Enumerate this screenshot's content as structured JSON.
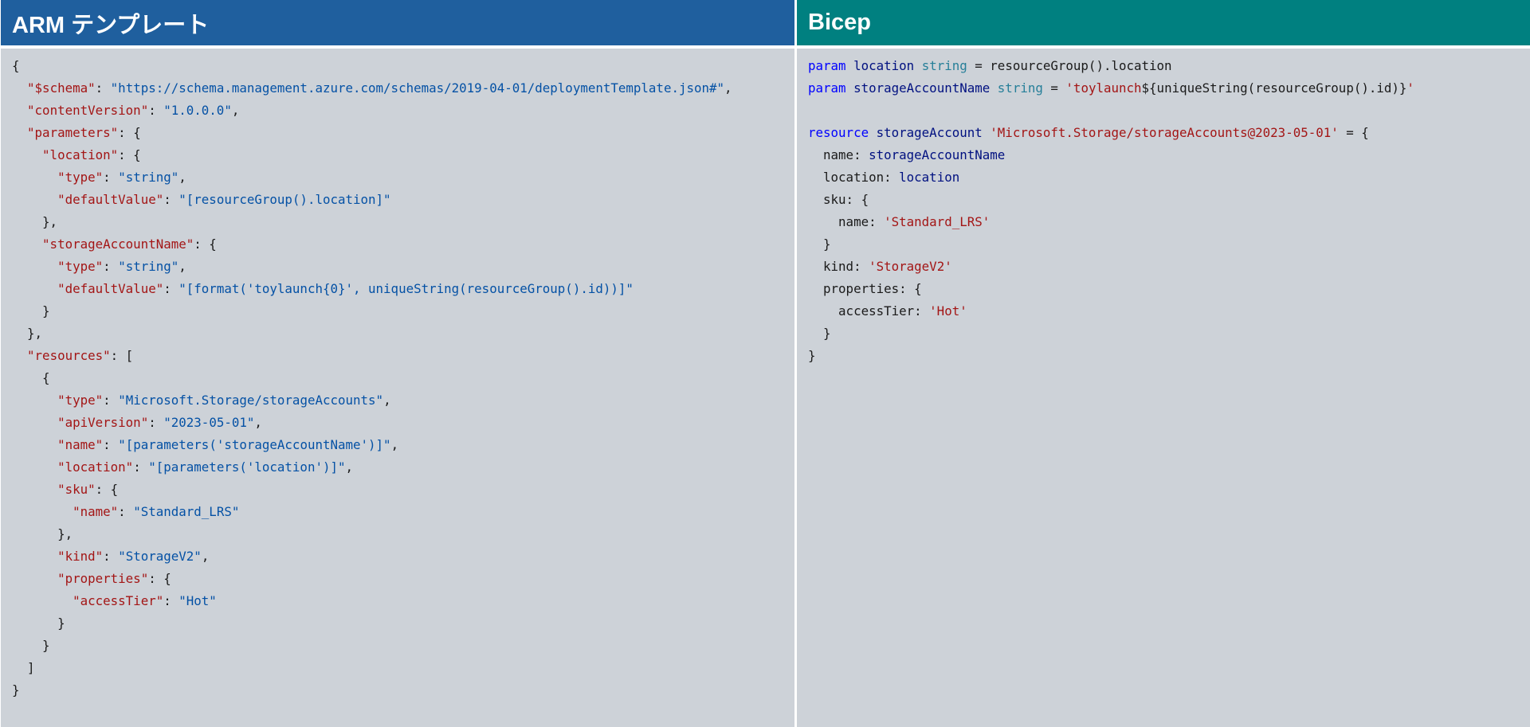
{
  "left": {
    "title": "ARM テンプレート",
    "lines": [
      [
        {
          "t": "p",
          "v": "{"
        }
      ],
      [
        {
          "t": "p",
          "v": "  "
        },
        {
          "t": "k",
          "v": "\"$schema\""
        },
        {
          "t": "p",
          "v": ": "
        },
        {
          "t": "v",
          "v": "\"https://schema.management.azure.com/schemas/2019-04-01/deploymentTemplate.json#\""
        },
        {
          "t": "p",
          "v": ","
        }
      ],
      [
        {
          "t": "p",
          "v": "  "
        },
        {
          "t": "k",
          "v": "\"contentVersion\""
        },
        {
          "t": "p",
          "v": ": "
        },
        {
          "t": "v",
          "v": "\"1.0.0.0\""
        },
        {
          "t": "p",
          "v": ","
        }
      ],
      [
        {
          "t": "p",
          "v": "  "
        },
        {
          "t": "k",
          "v": "\"parameters\""
        },
        {
          "t": "p",
          "v": ": {"
        }
      ],
      [
        {
          "t": "p",
          "v": "    "
        },
        {
          "t": "k",
          "v": "\"location\""
        },
        {
          "t": "p",
          "v": ": {"
        }
      ],
      [
        {
          "t": "p",
          "v": "      "
        },
        {
          "t": "k",
          "v": "\"type\""
        },
        {
          "t": "p",
          "v": ": "
        },
        {
          "t": "v",
          "v": "\"string\""
        },
        {
          "t": "p",
          "v": ","
        }
      ],
      [
        {
          "t": "p",
          "v": "      "
        },
        {
          "t": "k",
          "v": "\"defaultValue\""
        },
        {
          "t": "p",
          "v": ": "
        },
        {
          "t": "v",
          "v": "\"[resourceGroup().location]\""
        }
      ],
      [
        {
          "t": "p",
          "v": "    },"
        }
      ],
      [
        {
          "t": "p",
          "v": "    "
        },
        {
          "t": "k",
          "v": "\"storageAccountName\""
        },
        {
          "t": "p",
          "v": ": {"
        }
      ],
      [
        {
          "t": "p",
          "v": "      "
        },
        {
          "t": "k",
          "v": "\"type\""
        },
        {
          "t": "p",
          "v": ": "
        },
        {
          "t": "v",
          "v": "\"string\""
        },
        {
          "t": "p",
          "v": ","
        }
      ],
      [
        {
          "t": "p",
          "v": "      "
        },
        {
          "t": "k",
          "v": "\"defaultValue\""
        },
        {
          "t": "p",
          "v": ": "
        },
        {
          "t": "v",
          "v": "\"[format('toylaunch{0}', uniqueString(resourceGroup().id))]\""
        }
      ],
      [
        {
          "t": "p",
          "v": "    }"
        }
      ],
      [
        {
          "t": "p",
          "v": "  },"
        }
      ],
      [
        {
          "t": "p",
          "v": "  "
        },
        {
          "t": "k",
          "v": "\"resources\""
        },
        {
          "t": "p",
          "v": ": ["
        }
      ],
      [
        {
          "t": "p",
          "v": "    {"
        }
      ],
      [
        {
          "t": "p",
          "v": "      "
        },
        {
          "t": "k",
          "v": "\"type\""
        },
        {
          "t": "p",
          "v": ": "
        },
        {
          "t": "v",
          "v": "\"Microsoft.Storage/storageAccounts\""
        },
        {
          "t": "p",
          "v": ","
        }
      ],
      [
        {
          "t": "p",
          "v": "      "
        },
        {
          "t": "k",
          "v": "\"apiVersion\""
        },
        {
          "t": "p",
          "v": ": "
        },
        {
          "t": "v",
          "v": "\"2023-05-01\""
        },
        {
          "t": "p",
          "v": ","
        }
      ],
      [
        {
          "t": "p",
          "v": "      "
        },
        {
          "t": "k",
          "v": "\"name\""
        },
        {
          "t": "p",
          "v": ": "
        },
        {
          "t": "v",
          "v": "\"[parameters('storageAccountName')]\""
        },
        {
          "t": "p",
          "v": ","
        }
      ],
      [
        {
          "t": "p",
          "v": "      "
        },
        {
          "t": "k",
          "v": "\"location\""
        },
        {
          "t": "p",
          "v": ": "
        },
        {
          "t": "v",
          "v": "\"[parameters('location')]\""
        },
        {
          "t": "p",
          "v": ","
        }
      ],
      [
        {
          "t": "p",
          "v": "      "
        },
        {
          "t": "k",
          "v": "\"sku\""
        },
        {
          "t": "p",
          "v": ": {"
        }
      ],
      [
        {
          "t": "p",
          "v": "        "
        },
        {
          "t": "k",
          "v": "\"name\""
        },
        {
          "t": "p",
          "v": ": "
        },
        {
          "t": "v",
          "v": "\"Standard_LRS\""
        }
      ],
      [
        {
          "t": "p",
          "v": "      },"
        }
      ],
      [
        {
          "t": "p",
          "v": "      "
        },
        {
          "t": "k",
          "v": "\"kind\""
        },
        {
          "t": "p",
          "v": ": "
        },
        {
          "t": "v",
          "v": "\"StorageV2\""
        },
        {
          "t": "p",
          "v": ","
        }
      ],
      [
        {
          "t": "p",
          "v": "      "
        },
        {
          "t": "k",
          "v": "\"properties\""
        },
        {
          "t": "p",
          "v": ": {"
        }
      ],
      [
        {
          "t": "p",
          "v": "        "
        },
        {
          "t": "k",
          "v": "\"accessTier\""
        },
        {
          "t": "p",
          "v": ": "
        },
        {
          "t": "v",
          "v": "\"Hot\""
        }
      ],
      [
        {
          "t": "p",
          "v": "      }"
        }
      ],
      [
        {
          "t": "p",
          "v": "    }"
        }
      ],
      [
        {
          "t": "p",
          "v": "  ]"
        }
      ],
      [
        {
          "t": "p",
          "v": "}"
        }
      ]
    ]
  },
  "right": {
    "title": "Bicep",
    "lines": [
      [
        {
          "t": "kw",
          "v": "param"
        },
        {
          "t": "p",
          "v": " "
        },
        {
          "t": "id",
          "v": "location"
        },
        {
          "t": "p",
          "v": " "
        },
        {
          "t": "ty",
          "v": "string"
        },
        {
          "t": "p",
          "v": " = resourceGroup().location"
        }
      ],
      [
        {
          "t": "kw",
          "v": "param"
        },
        {
          "t": "p",
          "v": " "
        },
        {
          "t": "id",
          "v": "storageAccountName"
        },
        {
          "t": "p",
          "v": " "
        },
        {
          "t": "ty",
          "v": "string"
        },
        {
          "t": "p",
          "v": " = "
        },
        {
          "t": "s",
          "v": "'toylaunch"
        },
        {
          "t": "p",
          "v": "${uniqueString(resourceGroup().id)}"
        },
        {
          "t": "s",
          "v": "'"
        }
      ],
      [
        {
          "t": "p",
          "v": ""
        }
      ],
      [
        {
          "t": "kw",
          "v": "resource"
        },
        {
          "t": "p",
          "v": " "
        },
        {
          "t": "id",
          "v": "storageAccount"
        },
        {
          "t": "p",
          "v": " "
        },
        {
          "t": "s",
          "v": "'Microsoft.Storage/storageAccounts@2023-05-01'"
        },
        {
          "t": "p",
          "v": " = {"
        }
      ],
      [
        {
          "t": "p",
          "v": "  name: "
        },
        {
          "t": "id",
          "v": "storageAccountName"
        }
      ],
      [
        {
          "t": "p",
          "v": "  location: "
        },
        {
          "t": "id",
          "v": "location"
        }
      ],
      [
        {
          "t": "p",
          "v": "  sku: {"
        }
      ],
      [
        {
          "t": "p",
          "v": "    name: "
        },
        {
          "t": "s",
          "v": "'Standard_LRS'"
        }
      ],
      [
        {
          "t": "p",
          "v": "  }"
        }
      ],
      [
        {
          "t": "p",
          "v": "  kind: "
        },
        {
          "t": "s",
          "v": "'StorageV2'"
        }
      ],
      [
        {
          "t": "p",
          "v": "  properties: {"
        }
      ],
      [
        {
          "t": "p",
          "v": "    accessTier: "
        },
        {
          "t": "s",
          "v": "'Hot'"
        }
      ],
      [
        {
          "t": "p",
          "v": "  }"
        }
      ],
      [
        {
          "t": "p",
          "v": "}"
        }
      ]
    ]
  }
}
